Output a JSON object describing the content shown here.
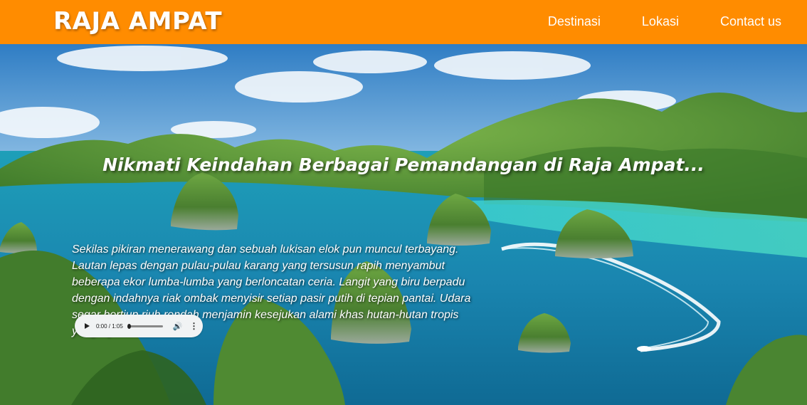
{
  "header": {
    "brand": "RAJA AMPAT",
    "nav": [
      {
        "label": "Destinasi"
      },
      {
        "label": "Lokasi"
      },
      {
        "label": "Contact us"
      }
    ],
    "accent_color": "#ff8c00"
  },
  "hero": {
    "headline": "Nikmati Keindahan Berbagai Pemandangan di Raja Ampat...",
    "description": "Sekilas pikiran menerawang dan sebuah lukisan elok pun muncul terbayang. Lautan lepas dengan pulau-pulau karang yang tersusun rapih menyambut beberapa ekor lumba-lumba yang berloncatan ceria. Langit yang biru berpadu dengan indahnya riak ombak menyisir setiap pasir putih di tepian pantai. Udara segar bertiup riuh rendah menjamin kesejukan alami khas hutan-hutan tropis yang hijau."
  },
  "audio_player": {
    "time": "0:00 / 1:05",
    "progress": 0,
    "icons": [
      "play-icon",
      "volume-icon",
      "more-options-icon"
    ]
  }
}
